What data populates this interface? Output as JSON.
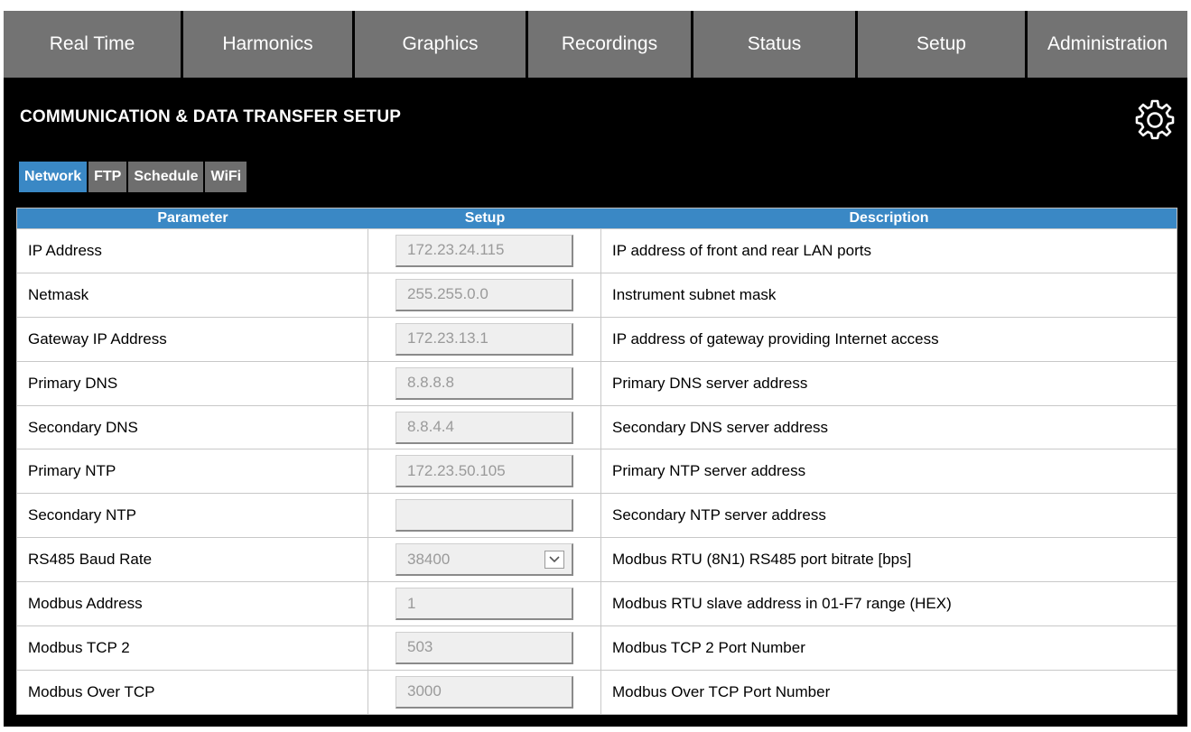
{
  "nav": {
    "items": [
      "Real Time",
      "Harmonics",
      "Graphics",
      "Recordings",
      "Status",
      "Setup",
      "Administration"
    ]
  },
  "page": {
    "title": "COMMUNICATION & DATA TRANSFER SETUP"
  },
  "subtabs": {
    "items": [
      "Network",
      "FTP",
      "Schedule",
      "WiFi"
    ],
    "active": "Network"
  },
  "table": {
    "headers": [
      "Parameter",
      "Setup",
      "Description"
    ],
    "rows": [
      {
        "parameter": "IP Address",
        "setup": "172.23.24.115",
        "description": "IP address of front and rear LAN ports"
      },
      {
        "parameter": "Netmask",
        "setup": "255.255.0.0",
        "description": "Instrument subnet mask"
      },
      {
        "parameter": "Gateway IP Address",
        "setup": "172.23.13.1",
        "description": "IP address of gateway providing Internet access"
      },
      {
        "parameter": "Primary DNS",
        "setup": "8.8.8.8",
        "description": "Primary DNS server address"
      },
      {
        "parameter": "Secondary DNS",
        "setup": "8.8.4.4",
        "description": "Secondary DNS server address"
      },
      {
        "parameter": "Primary NTP",
        "setup": "172.23.50.105",
        "description": "Primary NTP server address"
      },
      {
        "parameter": "Secondary NTP",
        "setup": "",
        "description": "Secondary NTP server address"
      },
      {
        "parameter": "RS485 Baud Rate",
        "setup": "38400",
        "description": "Modbus RTU (8N1) RS485 port bitrate [bps]"
      },
      {
        "parameter": "Modbus Address",
        "setup": "1",
        "description": "Modbus RTU slave address in 01-F7 range (HEX)"
      },
      {
        "parameter": "Modbus TCP 2",
        "setup": "503",
        "description": "Modbus TCP 2 Port Number"
      },
      {
        "parameter": "Modbus Over TCP",
        "setup": "3000",
        "description": "Modbus Over TCP Port Number"
      }
    ]
  },
  "icons": {
    "settings": "gear-icon",
    "dropdown": "chevron-down-icon"
  },
  "colors": {
    "nav_bg": "#737373",
    "header_bg": "#000000",
    "accent_blue": "#3a88c5",
    "subtab_bg": "#6e6e6e",
    "field_text": "#9a9a9a"
  }
}
